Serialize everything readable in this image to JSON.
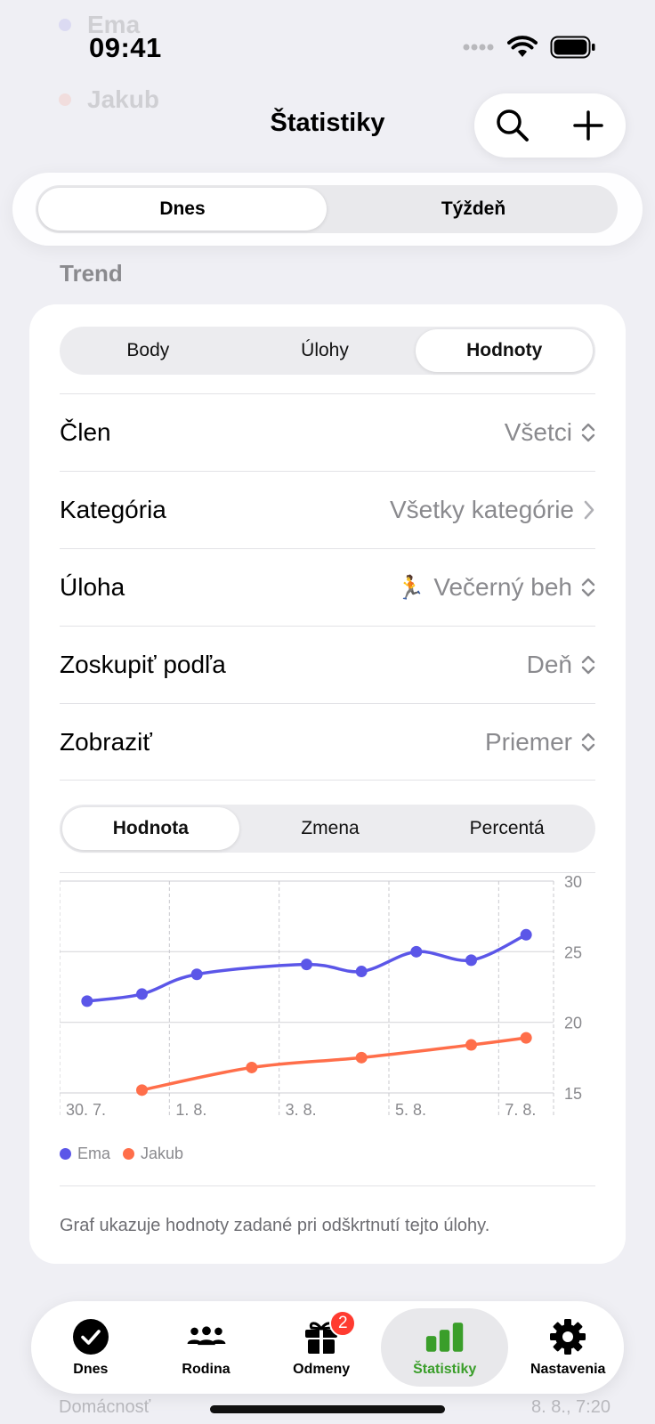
{
  "status_bar": {
    "time": "09:41"
  },
  "background_rows": [
    {
      "name": "Ema",
      "color": "#5b56e8"
    },
    {
      "name": "Jakub",
      "color": "#ff6e4a"
    }
  ],
  "bottom_background_row": {
    "category": "Domácnosť",
    "time": "8. 8., 7:20"
  },
  "header": {
    "title": "Štatistiky",
    "search_icon": "magnifier-icon",
    "add_icon": "plus-icon"
  },
  "period_segment": {
    "items": [
      "Dnes",
      "Týždeň"
    ],
    "selected": "Dnes"
  },
  "section": {
    "title": "Trend"
  },
  "metric_segment": {
    "items": [
      "Body",
      "Úlohy",
      "Hodnoty"
    ],
    "selected": "Hodnoty"
  },
  "filters": {
    "member": {
      "label": "Člen",
      "value": "Všetci"
    },
    "category": {
      "label": "Kategória",
      "value": "Všetky kategórie"
    },
    "task": {
      "label": "Úloha",
      "emoji": "🏃",
      "value": "Večerný beh"
    },
    "group_by": {
      "label": "Zoskupiť podľa",
      "value": "Deň"
    },
    "display": {
      "label": "Zobraziť",
      "value": "Priemer"
    }
  },
  "value_segment": {
    "items": [
      "Hodnota",
      "Zmena",
      "Percentá"
    ],
    "selected": "Hodnota"
  },
  "chart_data": {
    "type": "line",
    "x_ticks": [
      "30. 7.",
      "1. 8.",
      "3. 8.",
      "5. 8.",
      "7. 8."
    ],
    "y_ticks": [
      15,
      20,
      25,
      30
    ],
    "ylim": [
      15,
      30
    ],
    "grid": true,
    "legend_position": "bottom-left",
    "series": [
      {
        "name": "Ema",
        "color": "#5b56e8",
        "x": [
          "30. 7.",
          "31. 7.",
          "1. 8.",
          "3. 8.",
          "4. 8.",
          "5. 8.",
          "6. 8.",
          "7. 8."
        ],
        "values": [
          21.5,
          22.0,
          23.4,
          24.1,
          23.6,
          25.0,
          24.4,
          26.2
        ]
      },
      {
        "name": "Jakub",
        "color": "#ff6e4a",
        "x": [
          "31. 7.",
          "2. 8.",
          "4. 8.",
          "6. 8.",
          "7. 8."
        ],
        "values": [
          15.2,
          16.8,
          17.5,
          18.4,
          18.9
        ]
      }
    ]
  },
  "footnote": "Graf ukazuje hodnoty zadané pri odškrtnutí tejto úlohy.",
  "tabbar": {
    "items": [
      {
        "label": "Dnes",
        "icon": "checkmark-circle-icon"
      },
      {
        "label": "Rodina",
        "icon": "people-icon"
      },
      {
        "label": "Odmeny",
        "icon": "gift-icon",
        "badge": "2"
      },
      {
        "label": "Štatistiky",
        "icon": "bar-chart-icon"
      },
      {
        "label": "Nastavenia",
        "icon": "gear-icon"
      }
    ],
    "selected": "Štatistiky",
    "accent": "#3a9e2a"
  }
}
